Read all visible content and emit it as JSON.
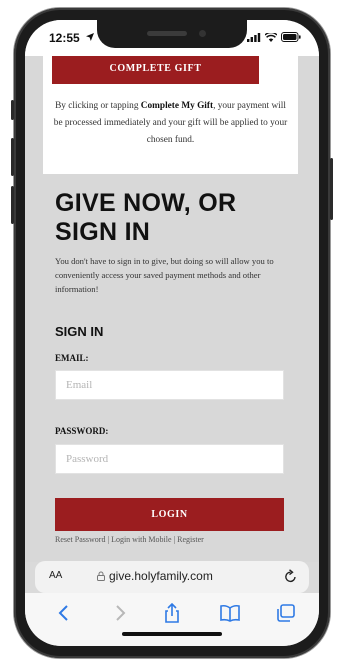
{
  "status_bar": {
    "time": "12:55"
  },
  "gift_card": {
    "complete_button": "COMPLETE GIFT",
    "note_before": "By clicking or tapping ",
    "note_bold": "Complete My Gift",
    "note_after": ", your payment will be processed immediately and your gift will be applied to your chosen fund."
  },
  "headline": {
    "line1": "GIVE NOW, OR",
    "line2": "SIGN IN"
  },
  "intro": "You don't have to sign in to give, but doing so will allow you to conveniently access your saved payment methods and other information!",
  "sign_in": {
    "title": "SIGN IN",
    "email_label": "EMAIL:",
    "email_placeholder": "Email",
    "password_label": "PASSWORD:",
    "password_placeholder": "Password",
    "login_button": "LOGIN",
    "links": {
      "reset": "Reset Password",
      "mobile": "Login with Mobile",
      "register": "Register",
      "separator": " | "
    }
  },
  "browser": {
    "aa_label": "AA",
    "url": "give.holyfamily.com"
  },
  "colors": {
    "accent": "#9b1d1f",
    "page_bg": "#d8d8d8"
  },
  "icons": [
    "location-arrow-icon",
    "signal-icon",
    "wifi-icon",
    "battery-icon",
    "lock-icon",
    "reload-icon",
    "back-icon",
    "forward-icon",
    "share-icon",
    "bookmarks-icon",
    "tabs-icon"
  ]
}
